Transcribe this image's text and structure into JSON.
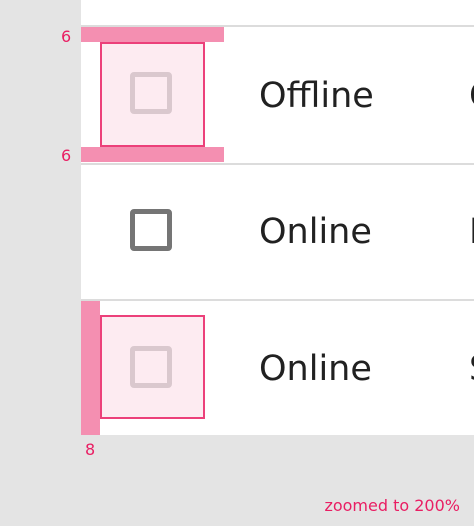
{
  "table": {
    "rows": [
      {
        "status": "Offline",
        "next": "C"
      },
      {
        "status": "Online",
        "next": "I"
      },
      {
        "status": "Online",
        "next": "S"
      }
    ]
  },
  "annotations": {
    "top_padding": "6",
    "bottom_padding": "6",
    "left_padding": "8",
    "zoom_note": "zoomed to 200%"
  },
  "colors": {
    "overlay_pink": "#f48fb1",
    "overlay_text": "#e91e63",
    "checkbox_border": "#757575"
  }
}
